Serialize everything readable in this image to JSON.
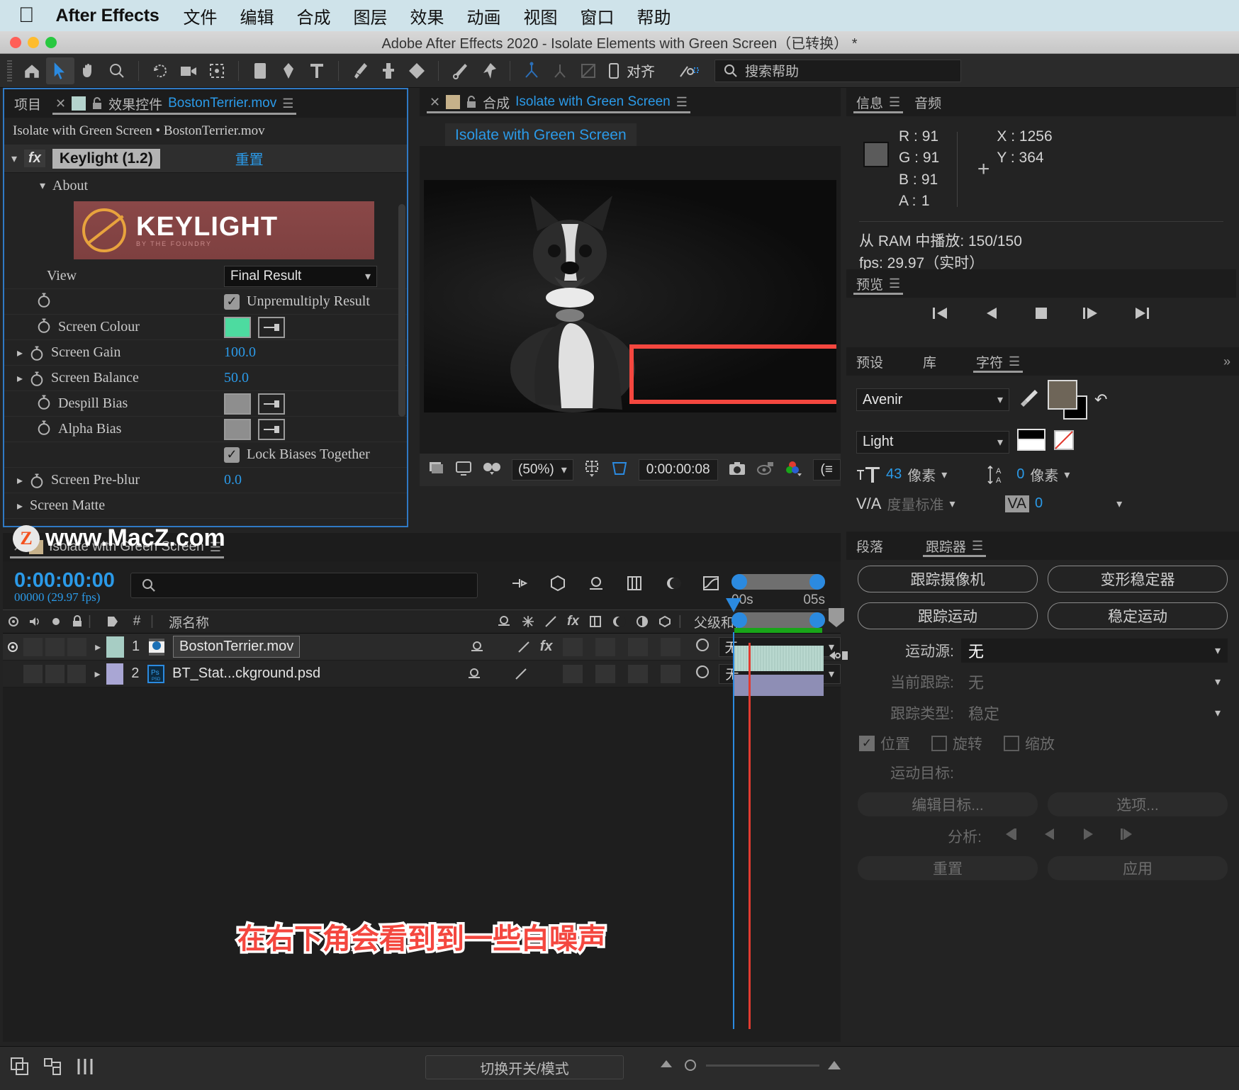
{
  "macmenu": {
    "app_label": "After Effects",
    "items": [
      "文件",
      "编辑",
      "合成",
      "图层",
      "效果",
      "动画",
      "视图",
      "窗口",
      "帮助"
    ]
  },
  "window": {
    "title": "Adobe After Effects 2020 - Isolate Elements with Green Screen（已转换）  *"
  },
  "toolbar": {
    "align_label": "对齐",
    "help_placeholder": "搜索帮助",
    "tools": [
      "home-icon",
      "selection-tool",
      "hand-tool",
      "zoom-tool",
      "rotation-tool",
      "camera-tool",
      "pan-behind-tool",
      "shape-tool",
      "pen-tool",
      "type-tool",
      "brush-tool",
      "clone-stamp-tool",
      "eraser-tool",
      "roto-brush-tool",
      "puppet-pin-tool"
    ]
  },
  "effect_controls": {
    "tab_project": "项目",
    "tab_label": "效果控件",
    "tab_file": "BostonTerrier.mov",
    "subtitle": "Isolate with Green Screen • BostonTerrier.mov",
    "effect_name": "Keylight (1.2)",
    "reset_label": "重置",
    "about_label": "About",
    "logo_text": "KEYLIGHT",
    "logo_sub": "BY THE FOUNDRY",
    "rows": [
      {
        "label": "View",
        "type": "select",
        "value": "Final Result"
      },
      {
        "label": "",
        "type": "checkbox",
        "value": "Unpremultiply Result",
        "checked": true
      },
      {
        "label": "Screen Colour",
        "type": "color",
        "value": "#4ddba0"
      },
      {
        "label": "Screen Gain",
        "type": "number",
        "value": "100.0"
      },
      {
        "label": "Screen Balance",
        "type": "number",
        "value": "50.0"
      },
      {
        "label": "Despill Bias",
        "type": "color",
        "value": "#8e8e8e"
      },
      {
        "label": "Alpha Bias",
        "type": "color",
        "value": "#8e8e8e"
      },
      {
        "label": "",
        "type": "checkbox",
        "value": "Lock Biases Together",
        "checked": true
      },
      {
        "label": "Screen Pre-blur",
        "type": "number",
        "value": "0.0"
      },
      {
        "label": "Screen Matte",
        "type": "group",
        "value": ""
      }
    ]
  },
  "watermark": {
    "badge": "Z",
    "text": "www.MacZ.com"
  },
  "composition": {
    "tab_label": "合成",
    "comp_name": "Isolate with Green Screen",
    "name_tag": "Isolate with Green Screen",
    "zoom": "(50%)",
    "timecode": "0:00:00:08"
  },
  "info": {
    "tab_info": "信息",
    "tab_audio": "音频",
    "r_label": "R :",
    "r_value": "91",
    "g_label": "G :",
    "g_value": "91",
    "b_label": "B :",
    "b_value": "91",
    "a_label": "A :",
    "a_value": "1",
    "x_label": "X :",
    "x_value": "1256",
    "y_label": "Y :",
    "y_value": "364",
    "ram_line": "从 RAM 中播放: 150/150",
    "fps_line": "fps: 29.97（实时）",
    "swatch_color": "#5b5b5b"
  },
  "preview": {
    "tab_label": "预览"
  },
  "character": {
    "tab_preset": "预设",
    "tab_library": "库",
    "tab_character": "字符",
    "font_family": "Avenir",
    "font_style": "Light",
    "font_size": "43",
    "size_unit": "像素",
    "leading": "0",
    "leading_unit": "像素",
    "kerning_label": "度量标准",
    "tracking": "0",
    "fill_color": "#6e6558",
    "stroke_color": "#000000"
  },
  "tracker": {
    "tab_paragraph": "段落",
    "tab_tracker": "跟踪器",
    "btn_track_camera": "跟踪摄像机",
    "btn_warp_stabilizer": "变形稳定器",
    "btn_track_motion": "跟踪运动",
    "btn_stabilize_motion": "稳定运动",
    "motion_source_label": "运动源:",
    "motion_source_value": "无",
    "current_track_label": "当前跟踪:",
    "current_track_value": "无",
    "track_type_label": "跟踪类型:",
    "track_type_value": "稳定",
    "check_position": "位置",
    "check_rotation": "旋转",
    "check_scale": "缩放",
    "motion_target_label": "运动目标:",
    "btn_edit_target": "编辑目标...",
    "btn_options": "选项...",
    "analyze_label": "分析:",
    "btn_reset": "重置",
    "btn_apply": "应用"
  },
  "timeline": {
    "tab_label": "Isolate with Green Screen",
    "current_time": "0:00:00:00",
    "frame_info": "00000 (29.97 fps)",
    "columns": {
      "source_name": "源名称",
      "number": "#",
      "parent": "父级和链接"
    },
    "layers": [
      {
        "index": "1",
        "name": "BostonTerrier.mov",
        "kind": "mov",
        "parent": "无",
        "color": "#a7cdc4",
        "has_fx": true,
        "visible": true
      },
      {
        "index": "2",
        "name": "BT_Stat...ckground.psd",
        "kind": "psd",
        "parent": "无",
        "color": "#a9a6d4",
        "has_fx": false,
        "visible": false
      }
    ],
    "ruler": {
      "start": "00s",
      "end": "05s"
    },
    "subtitle": "在右下角会看到到一些白噪声"
  },
  "bottom": {
    "toggle_label": "切换开关/模式"
  }
}
